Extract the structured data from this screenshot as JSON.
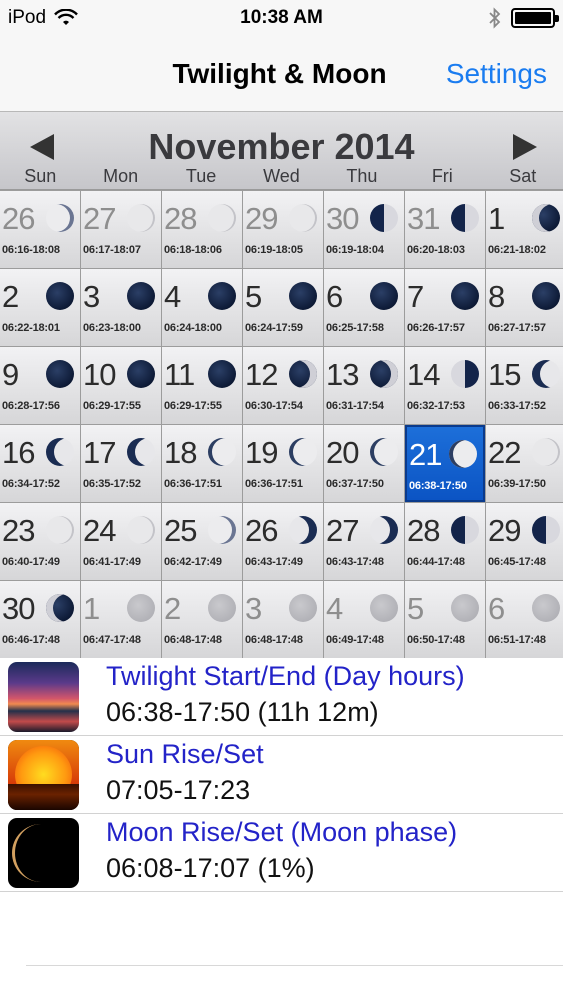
{
  "status_bar": {
    "carrier": "iPod",
    "time": "10:38 AM"
  },
  "nav": {
    "title": "Twilight & Moon",
    "settings_label": "Settings"
  },
  "calendar": {
    "month_label": "November 2014",
    "weekdays": [
      "Sun",
      "Mon",
      "Tue",
      "Wed",
      "Thu",
      "Fri",
      "Sat"
    ],
    "weeks": [
      [
        {
          "day": "26",
          "times": "06:16-18:08",
          "phase": "thin-r",
          "other": true
        },
        {
          "day": "27",
          "times": "06:17-18:07",
          "phase": "light",
          "other": true
        },
        {
          "day": "28",
          "times": "06:18-18:06",
          "phase": "light",
          "other": true
        },
        {
          "day": "29",
          "times": "06:19-18:05",
          "phase": "light",
          "other": true
        },
        {
          "day": "30",
          "times": "06:19-18:04",
          "phase": "half-l",
          "other": true
        },
        {
          "day": "31",
          "times": "06:20-18:03",
          "phase": "half-l",
          "other": true
        },
        {
          "day": "1",
          "times": "06:21-18:02",
          "phase": "gibbous-l",
          "other": false
        }
      ],
      [
        {
          "day": "2",
          "times": "06:22-18:01",
          "phase": "dark",
          "other": false
        },
        {
          "day": "3",
          "times": "06:23-18:00",
          "phase": "dark",
          "other": false
        },
        {
          "day": "4",
          "times": "06:24-18:00",
          "phase": "dark",
          "other": false
        },
        {
          "day": "5",
          "times": "06:24-17:59",
          "phase": "dark",
          "other": false
        },
        {
          "day": "6",
          "times": "06:25-17:58",
          "phase": "dark",
          "other": false
        },
        {
          "day": "7",
          "times": "06:26-17:57",
          "phase": "dark",
          "other": false
        },
        {
          "day": "8",
          "times": "06:27-17:57",
          "phase": "dark",
          "other": false
        }
      ],
      [
        {
          "day": "9",
          "times": "06:28-17:56",
          "phase": "dark",
          "other": false
        },
        {
          "day": "10",
          "times": "06:29-17:55",
          "phase": "dark",
          "other": false
        },
        {
          "day": "11",
          "times": "06:29-17:55",
          "phase": "dark",
          "other": false
        },
        {
          "day": "12",
          "times": "06:30-17:54",
          "phase": "gibbous-r",
          "other": false
        },
        {
          "day": "13",
          "times": "06:31-17:54",
          "phase": "gibbous-r",
          "other": false
        },
        {
          "day": "14",
          "times": "06:32-17:53",
          "phase": "half-r",
          "other": false
        },
        {
          "day": "15",
          "times": "06:33-17:52",
          "phase": "crescent-l",
          "other": false
        }
      ],
      [
        {
          "day": "16",
          "times": "06:34-17:52",
          "phase": "crescent-l",
          "other": false
        },
        {
          "day": "17",
          "times": "06:35-17:52",
          "phase": "crescent-l",
          "other": false
        },
        {
          "day": "18",
          "times": "06:36-17:51",
          "phase": "thin-l",
          "other": false
        },
        {
          "day": "19",
          "times": "06:36-17:51",
          "phase": "thin-l",
          "other": false
        },
        {
          "day": "20",
          "times": "06:37-17:50",
          "phase": "thin-l",
          "other": false
        },
        {
          "day": "21",
          "times": "06:38-17:50",
          "phase": "thin-l",
          "other": false,
          "selected": true
        },
        {
          "day": "22",
          "times": "06:39-17:50",
          "phase": "light",
          "other": false
        }
      ],
      [
        {
          "day": "23",
          "times": "06:40-17:49",
          "phase": "light",
          "other": false
        },
        {
          "day": "24",
          "times": "06:41-17:49",
          "phase": "light",
          "other": false
        },
        {
          "day": "25",
          "times": "06:42-17:49",
          "phase": "thin-r",
          "other": false
        },
        {
          "day": "26",
          "times": "06:43-17:49",
          "phase": "crescent-r",
          "other": false
        },
        {
          "day": "27",
          "times": "06:43-17:48",
          "phase": "crescent-r",
          "other": false
        },
        {
          "day": "28",
          "times": "06:44-17:48",
          "phase": "half-l",
          "other": false
        },
        {
          "day": "29",
          "times": "06:45-17:48",
          "phase": "half-l",
          "other": false
        }
      ],
      [
        {
          "day": "30",
          "times": "06:46-17:48",
          "phase": "gibbous-l",
          "other": false
        },
        {
          "day": "1",
          "times": "06:47-17:48",
          "phase": "grey",
          "other": true
        },
        {
          "day": "2",
          "times": "06:48-17:48",
          "phase": "grey",
          "other": true
        },
        {
          "day": "3",
          "times": "06:48-17:48",
          "phase": "grey",
          "other": true
        },
        {
          "day": "4",
          "times": "06:49-17:48",
          "phase": "grey",
          "other": true
        },
        {
          "day": "5",
          "times": "06:50-17:48",
          "phase": "grey",
          "other": true
        },
        {
          "day": "6",
          "times": "06:51-17:48",
          "phase": "grey",
          "other": true
        }
      ]
    ]
  },
  "info": [
    {
      "label": "Twilight Start/End (Day hours)",
      "value": "06:38-17:50 (11h 12m)",
      "icon": "twilight-icon"
    },
    {
      "label": "Sun Rise/Set",
      "value": "07:05-17:23",
      "icon": "sun-icon"
    },
    {
      "label": "Moon Rise/Set (Moon phase)",
      "value": "06:08-17:07 (1%)",
      "icon": "moon-icon"
    }
  ],
  "colors": {
    "accent": "#1a7cf0",
    "link_text": "#2323c8",
    "selected_day": "#0b54c4"
  }
}
